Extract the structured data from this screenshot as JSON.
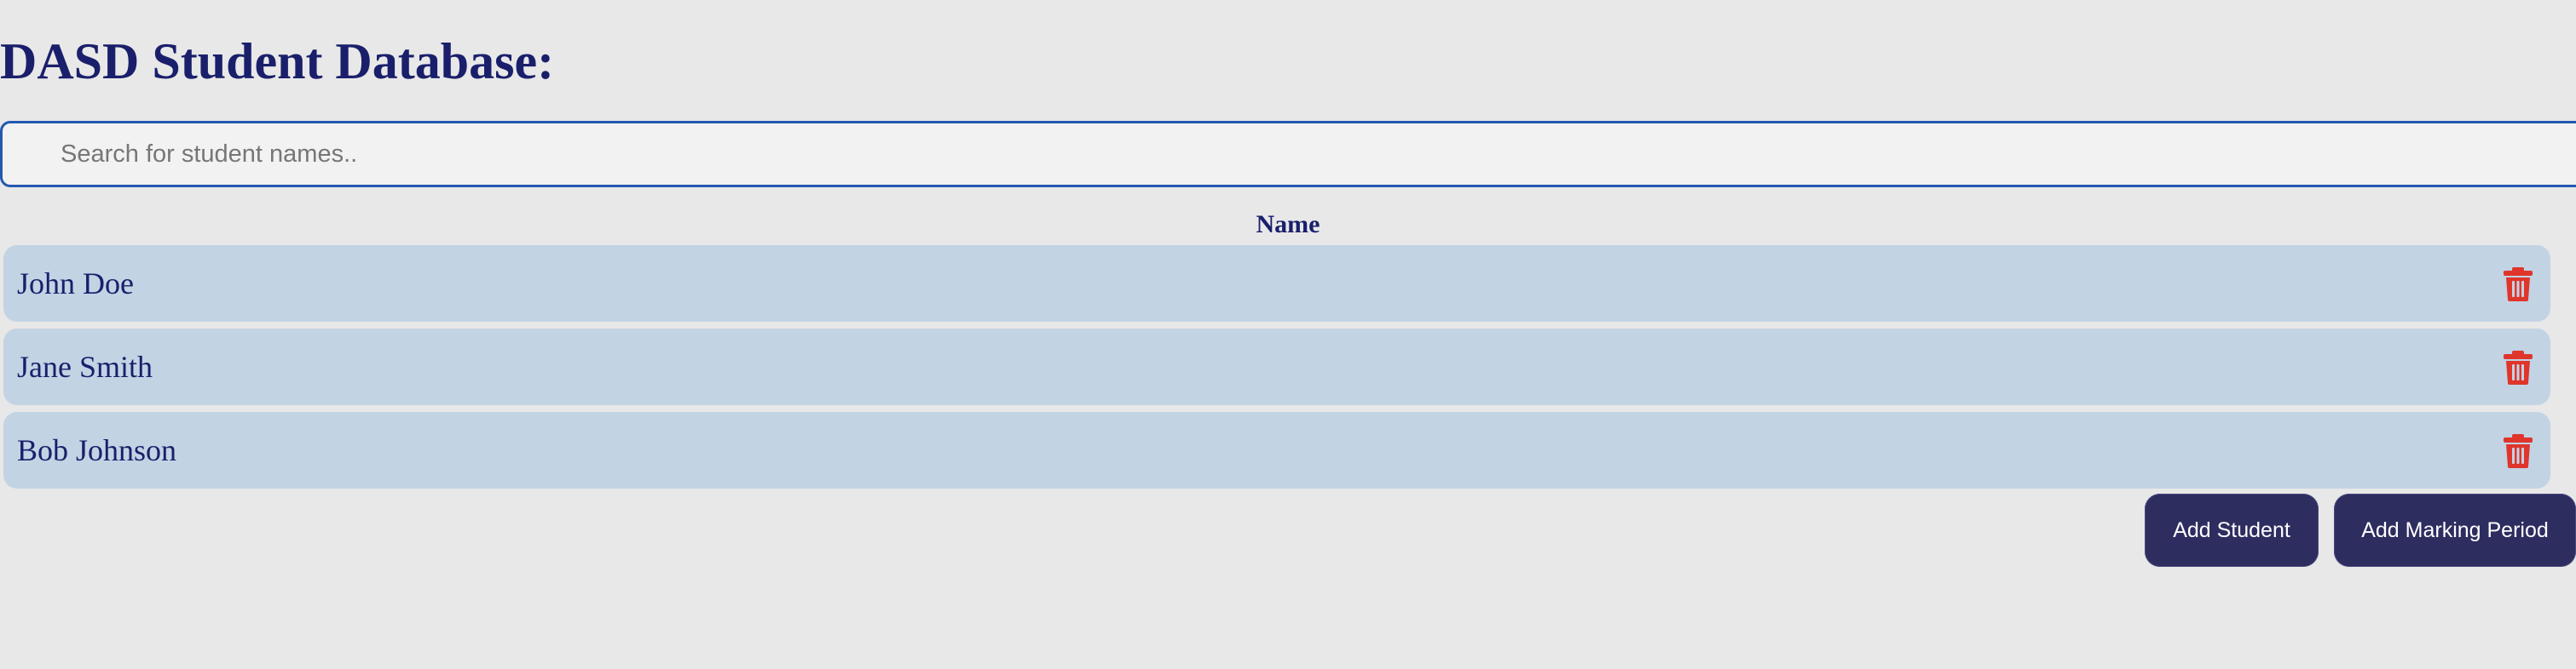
{
  "header": {
    "title": "DASD Student Database:"
  },
  "search": {
    "placeholder": "Search for student names..",
    "value": ""
  },
  "table": {
    "column_header": "Name",
    "rows": [
      {
        "name": "John Doe",
        "action_icon": "trash-icon"
      },
      {
        "name": "Jane Smith",
        "action_icon": "trash-icon"
      },
      {
        "name": "Bob Johnson",
        "action_icon": "trash-icon"
      }
    ]
  },
  "actions": {
    "add_student_label": "Add Student",
    "add_marking_period_label": "Add Marking Period"
  },
  "colors": {
    "background": "#e8e8e8",
    "title_text": "#1a1f6b",
    "search_border": "#2358b0",
    "row_background": "#c2d3e4",
    "delete_icon": "#e0352b",
    "button_background": "#2e2d60",
    "button_text": "#ffffff"
  }
}
